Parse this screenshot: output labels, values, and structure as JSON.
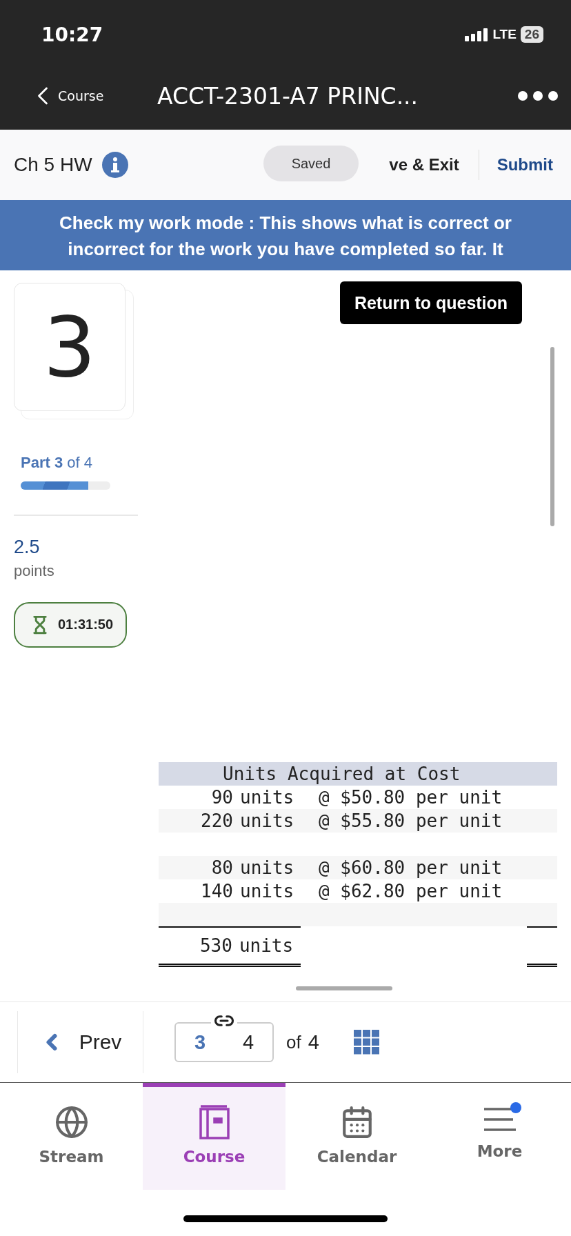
{
  "status_bar": {
    "time": "10:27",
    "network": "LTE",
    "battery": "26"
  },
  "nav_bar": {
    "back": "Course",
    "title": "ACCT-2301-A7 PRINC..."
  },
  "header": {
    "title": "Ch 5 HW",
    "toast": "Saved",
    "save_exit": "ve & Exit",
    "submit": "Submit"
  },
  "banner": "Check my work mode : This shows what is correct or incorrect for the work you have completed so far. It",
  "sidebar": {
    "question_number": "3",
    "part": "**Part 3** of 4",
    "progress": {
      "level": 0.75
    },
    "points": "2.5",
    "points_label": "points",
    "timer": "01:31:50"
  },
  "return_button": "Return to question",
  "table": {
    "title": "Units Acquired at Cost",
    "rows": [
      {
        "kind": "entry",
        "qty": "90",
        "unit": "units",
        "cost": "@ $50.80 per unit"
      },
      {
        "kind": "entry",
        "qty": "220",
        "unit": "units",
        "cost": "@ $55.80 per unit"
      },
      {
        "kind": "blank"
      },
      {
        "kind": "entry",
        "qty": "80",
        "unit": "units",
        "cost": "@ $60.80 per unit"
      },
      {
        "kind": "entry",
        "qty": "140",
        "unit": "units",
        "cost": "@ $62.80 per unit"
      },
      {
        "kind": "blank"
      },
      {
        "kind": "total",
        "qty": "530",
        "unit": "units"
      }
    ]
  },
  "pagination": {
    "prev": "Prev",
    "current": "3",
    "input": "4",
    "of": "of",
    "total": "4"
  },
  "tabs": [
    {
      "label": "Stream",
      "kind": "globe",
      "selected": false,
      "badge": false
    },
    {
      "label": "Course",
      "kind": "book",
      "selected": true,
      "badge": false
    },
    {
      "label": "Calendar",
      "kind": "calendar",
      "selected": false,
      "badge": false
    },
    {
      "label": "More",
      "kind": "menu",
      "selected": false,
      "badge": true
    }
  ]
}
